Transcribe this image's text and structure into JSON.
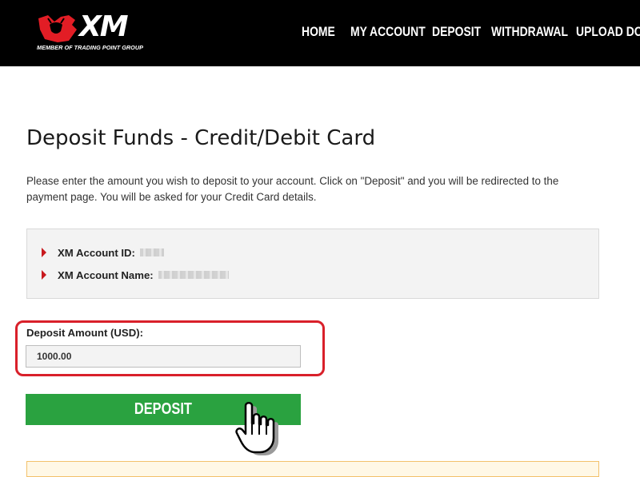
{
  "header": {
    "logo_text": "XM",
    "logo_tagline": "MEMBER OF TRADING POINT GROUP",
    "nav": [
      {
        "label": "HOME"
      },
      {
        "label": "MY ACCOUNT"
      },
      {
        "label": "DEPOSIT"
      },
      {
        "label": "WITHDRAWAL"
      },
      {
        "label": "UPLOAD DOCU"
      }
    ]
  },
  "main": {
    "title": "Deposit Funds - Credit/Debit Card",
    "intro": "Please enter the amount you wish to deposit to your account. Click on \"Deposit\" and you will be redirected to the payment page. You will be asked for your Credit Card details.",
    "account": {
      "id_label": "XM Account ID:",
      "name_label": "XM Account Name:"
    },
    "form": {
      "amount_label": "Deposit Amount (USD):",
      "amount_value": "1000.00",
      "submit_label": "DEPOSIT"
    }
  },
  "colors": {
    "brand_red": "#c8191e",
    "highlight_red": "#d9202a",
    "deposit_green": "#2aa240",
    "header_bg": "#000000"
  }
}
